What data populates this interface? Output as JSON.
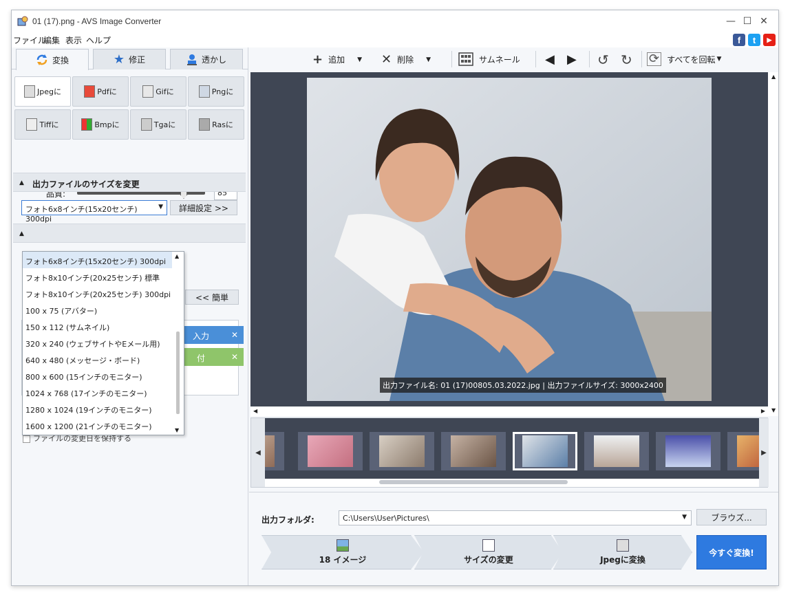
{
  "window": {
    "title": "01 (17).png - AVS Image Converter",
    "controls": {
      "minimize": "—",
      "maximize": "☐",
      "close": "✕"
    }
  },
  "menu": [
    "ファイル",
    "編集",
    "表示",
    "ヘルプ"
  ],
  "social": {
    "facebook": "f",
    "twitter": "t",
    "youtube": "▶"
  },
  "tabs": [
    {
      "label": "変換",
      "icon": "convert-icon",
      "active": true
    },
    {
      "label": "修正",
      "icon": "star-icon",
      "active": false
    },
    {
      "label": "透かし",
      "icon": "stamp-icon",
      "active": false
    }
  ],
  "formats": [
    {
      "label": "Jpegに",
      "active": true
    },
    {
      "label": "Pdfに"
    },
    {
      "label": "Gifに"
    },
    {
      "label": "Pngに"
    },
    {
      "label": "Tiffに"
    },
    {
      "label": "Bmpに"
    },
    {
      "label": "Tgaに"
    },
    {
      "label": "Rasに"
    }
  ],
  "quality": {
    "label": "品質:",
    "value": "85",
    "level_percent": 85
  },
  "resize_section": {
    "title": "出力ファイルのサイズを変更",
    "selected": "フォト6x8インチ(15x20センチ) 300dpi",
    "details_button": "詳細設定 >>",
    "simple_button": "<< 簡単"
  },
  "dropdown_items": [
    "フォト6x8インチ(15x20センチ) 300dpi",
    "フォト8x10インチ(20x25センチ) 標準",
    "フォト8x10インチ(20x25センチ) 300dpi",
    "100 x 75 (アバター)",
    "150 x 112 (サムネイル)",
    "320 x 240 (ウェブサイトやEメール用)",
    "640 x 480 (メッセージ・ボード)",
    "800 x 600 (15インチのモニター)",
    "1024 x 768 (17インチのモニター)",
    "1280 x 1024 (19インチのモニター)",
    "1600 x 1200 (21インチのモニター)"
  ],
  "hidden_buttons": {
    "input": "入力",
    "attach": "付",
    "remove": "✕"
  },
  "checkbox": {
    "label": "ファイルの変更日を保持する"
  },
  "toolbar": {
    "add": "追加",
    "delete": "削除",
    "thumbnail": "サムネール",
    "rotate_all": "すべてを回転"
  },
  "preview": {
    "caption": "出力ファイル名: 01 (17)00805.03.2022.jpg | 出力ファイルサイズ: 3000x2400"
  },
  "output": {
    "label": "出力フォルダ:",
    "path": "C:\\Users\\User\\Pictures\\",
    "browse": "ブラウズ..."
  },
  "steps": [
    {
      "label": "18 イメージ"
    },
    {
      "label": "サイズの変更"
    },
    {
      "label": "Jpegに変換"
    }
  ],
  "convert_button": "今すぐ変換!"
}
